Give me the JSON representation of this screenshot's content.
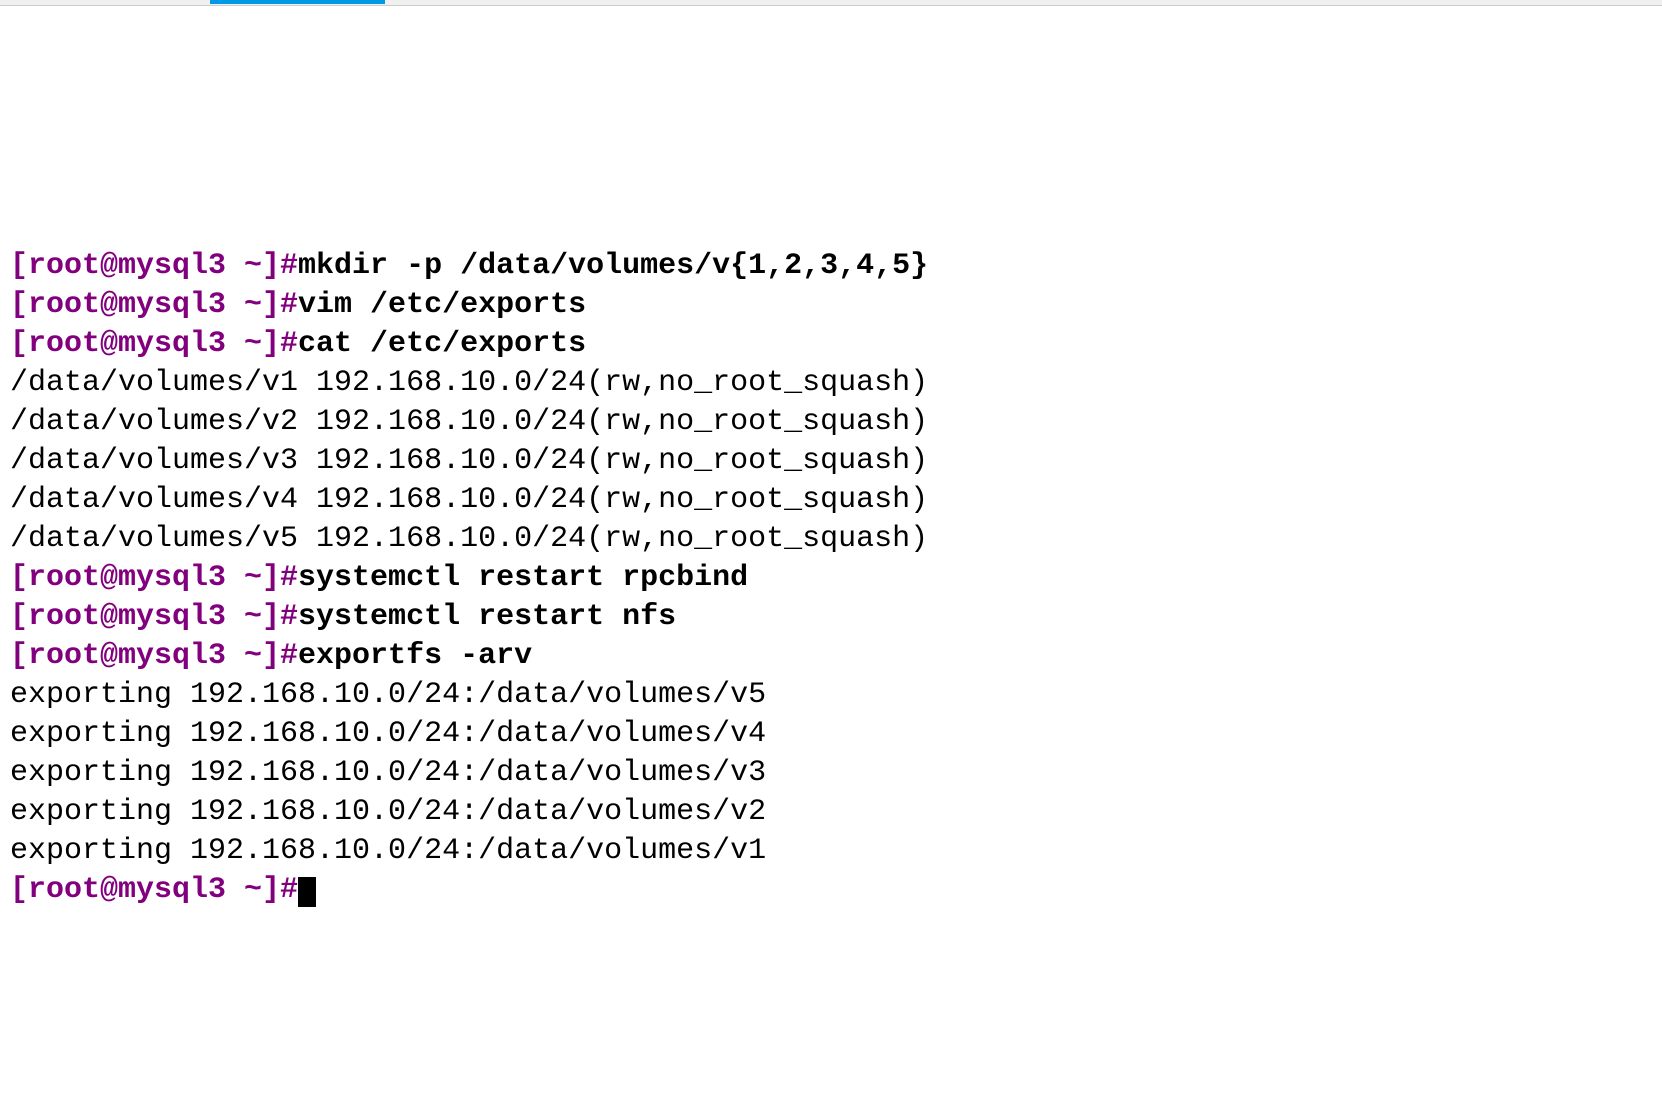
{
  "terminal": {
    "lines": [
      {
        "type": "prompt-cmd",
        "prompt": "[root@mysql3 ~]#",
        "command": "mkdir -p /data/volumes/v{1,2,3,4,5}"
      },
      {
        "type": "prompt-cmd",
        "prompt": "[root@mysql3 ~]#",
        "command": "vim /etc/exports"
      },
      {
        "type": "prompt-cmd",
        "prompt": "[root@mysql3 ~]#",
        "command": "cat /etc/exports"
      },
      {
        "type": "output",
        "text": "/data/volumes/v1 192.168.10.0/24(rw,no_root_squash)"
      },
      {
        "type": "output",
        "text": "/data/volumes/v2 192.168.10.0/24(rw,no_root_squash)"
      },
      {
        "type": "output",
        "text": "/data/volumes/v3 192.168.10.0/24(rw,no_root_squash)"
      },
      {
        "type": "output",
        "text": "/data/volumes/v4 192.168.10.0/24(rw,no_root_squash)"
      },
      {
        "type": "output",
        "text": "/data/volumes/v5 192.168.10.0/24(rw,no_root_squash)"
      },
      {
        "type": "prompt-cmd",
        "prompt": "[root@mysql3 ~]#",
        "command": "systemctl restart rpcbind"
      },
      {
        "type": "prompt-cmd",
        "prompt": "[root@mysql3 ~]#",
        "command": "systemctl restart nfs"
      },
      {
        "type": "prompt-cmd",
        "prompt": "[root@mysql3 ~]#",
        "command": "exportfs -arv"
      },
      {
        "type": "output",
        "text": "exporting 192.168.10.0/24:/data/volumes/v5"
      },
      {
        "type": "output",
        "text": "exporting 192.168.10.0/24:/data/volumes/v4"
      },
      {
        "type": "output",
        "text": "exporting 192.168.10.0/24:/data/volumes/v3"
      },
      {
        "type": "output",
        "text": "exporting 192.168.10.0/24:/data/volumes/v2"
      },
      {
        "type": "output",
        "text": "exporting 192.168.10.0/24:/data/volumes/v1"
      },
      {
        "type": "prompt-cursor",
        "prompt": "[root@mysql3 ~]#"
      }
    ]
  }
}
